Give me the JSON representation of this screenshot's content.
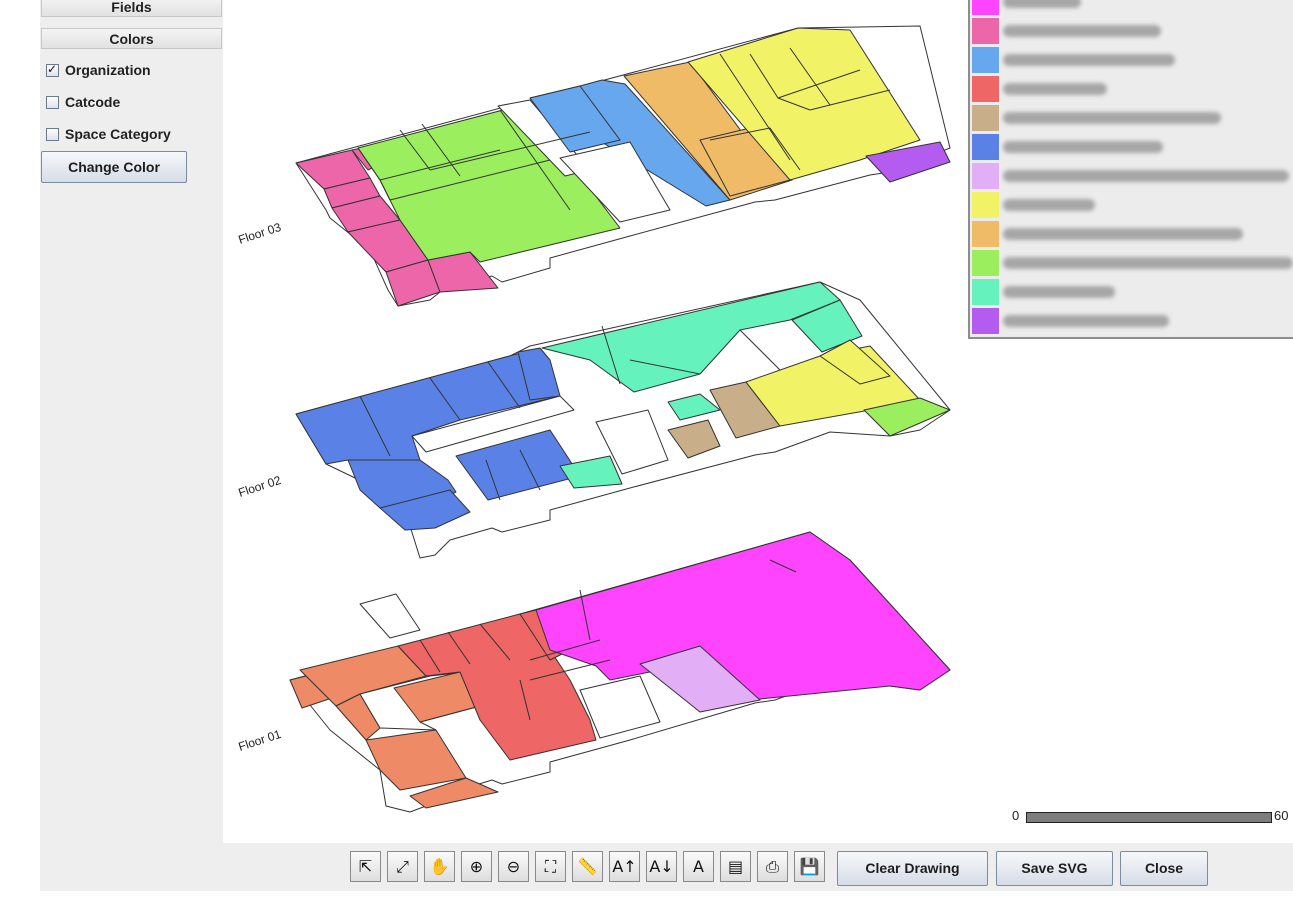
{
  "sidebar": {
    "fields_label": "Fields",
    "colors_label": "Colors",
    "options": [
      {
        "label": "Organization",
        "checked": true
      },
      {
        "label": "Catcode",
        "checked": false
      },
      {
        "label": "Space Category",
        "checked": false
      }
    ],
    "change_color_label": "Change Color"
  },
  "floors": [
    "Floor 03",
    "Floor 02",
    "Floor 01"
  ],
  "legend": {
    "swatches": [
      "#ff44ff",
      "#ee66aa",
      "#66a7ee",
      "#ee6666",
      "#c9ae8a",
      "#5a82e6",
      "#e2aef5",
      "#f2f267",
      "#f0bb66",
      "#9bef5e",
      "#66f2bd",
      "#b55cf0",
      "#ef8a66"
    ]
  },
  "scale": {
    "start": "0",
    "end": "60"
  },
  "toolbar": {
    "icons": [
      "select-icon",
      "fit-icon",
      "pan-icon",
      "zoom-in-icon",
      "zoom-out-icon",
      "zoom-extent-icon",
      "measure-icon",
      "font-up-icon",
      "font-down-icon",
      "label-icon",
      "export-icon",
      "print-icon",
      "save-icon"
    ],
    "clear_label": "Clear Drawing",
    "save_svg_label": "Save SVG",
    "close_label": "Close"
  }
}
